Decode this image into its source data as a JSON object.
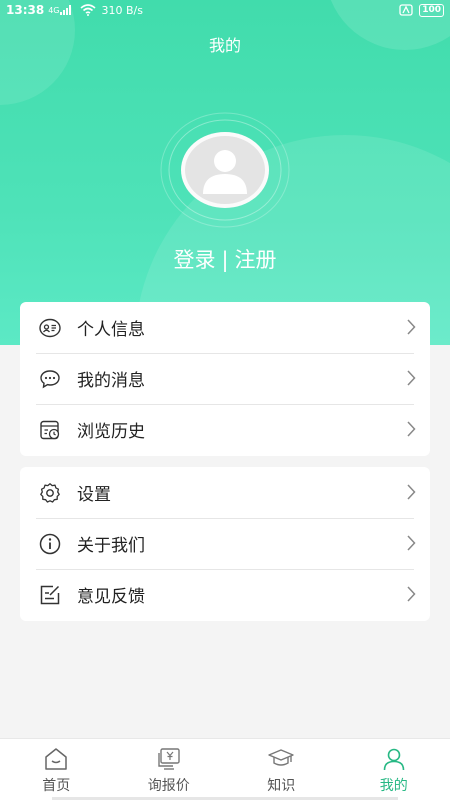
{
  "status_bar": {
    "time": "13:38",
    "network": "4G",
    "speed": "310 B/s",
    "battery": "100"
  },
  "header": {
    "title": "我的"
  },
  "auth": {
    "login": "登录",
    "separator": "|",
    "register": "注册"
  },
  "menu_group_1": [
    {
      "label": "个人信息",
      "icon": "id-card-icon"
    },
    {
      "label": "我的消息",
      "icon": "chat-bubble-icon"
    },
    {
      "label": "浏览历史",
      "icon": "history-icon"
    }
  ],
  "menu_group_2": [
    {
      "label": "设置",
      "icon": "gear-icon"
    },
    {
      "label": "关于我们",
      "icon": "info-icon"
    },
    {
      "label": "意见反馈",
      "icon": "feedback-icon"
    }
  ],
  "bottom_nav": [
    {
      "label": "首页",
      "icon": "home-icon"
    },
    {
      "label": "询报价",
      "icon": "quote-icon"
    },
    {
      "label": "知识",
      "icon": "graduation-cap-icon"
    },
    {
      "label": "我的",
      "icon": "user-icon",
      "active": true
    }
  ],
  "colors": {
    "accent": "#41dcac",
    "active_nav": "#27b884"
  }
}
